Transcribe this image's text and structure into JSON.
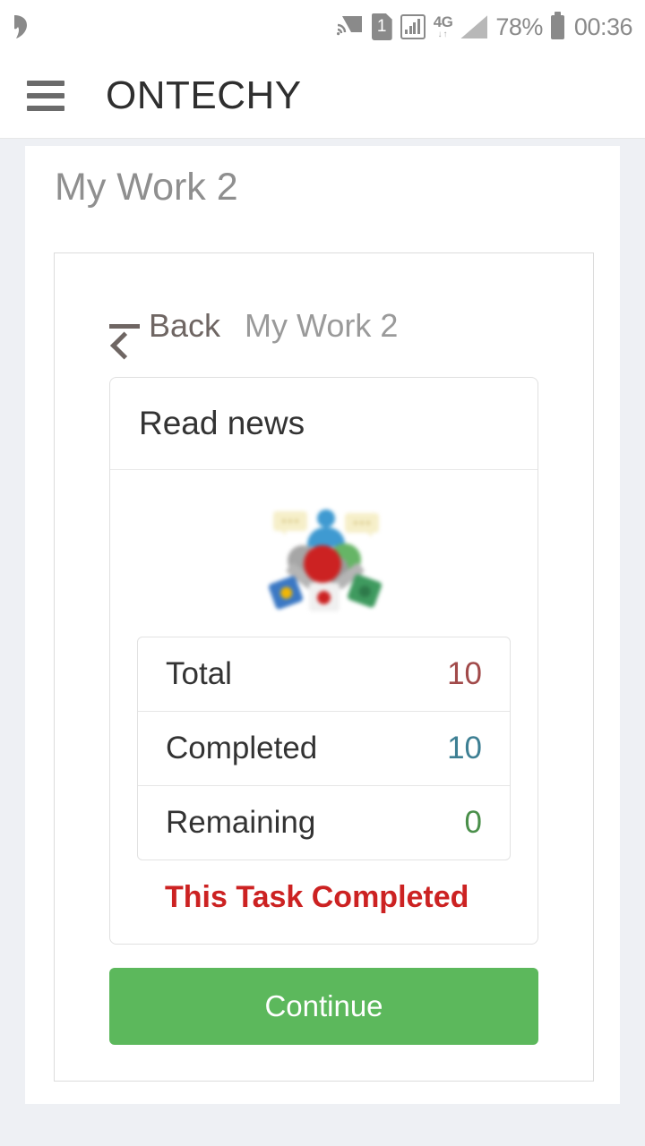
{
  "status_bar": {
    "notification_icon": "app-notification-icon",
    "cast_icon": "cast-icon",
    "sim_icon": "sim-card-icon",
    "sim_label": "1",
    "signal_box_icon": "signal-strength-boxed-icon",
    "network_label": "4G",
    "network_arrows": "↓↑",
    "signal_triangle_icon": "signal-bars-icon",
    "battery_percent": "78%",
    "battery_icon": "battery-icon",
    "clock": "00:36"
  },
  "app_bar": {
    "menu_icon": "hamburger-menu-icon",
    "brand": "ONTECHY"
  },
  "page": {
    "title": "My Work 2"
  },
  "breadcrumb": {
    "back_icon": "arrow-left-icon",
    "back_label": "Back",
    "current": "My Work 2"
  },
  "task_card": {
    "title": "Read news",
    "illustration_name": "team-collaboration-illustration",
    "status_message": "This Task Completed",
    "status_color": "#cc2222"
  },
  "stats": {
    "rows": [
      {
        "label": "Total",
        "value": "10",
        "color": "#a14a4a"
      },
      {
        "label": "Completed",
        "value": "10",
        "color": "#3d7f93"
      },
      {
        "label": "Remaining",
        "value": "0",
        "color": "#4a8f4a"
      }
    ]
  },
  "actions": {
    "continue_label": "Continue",
    "continue_color": "#5cb85c"
  }
}
